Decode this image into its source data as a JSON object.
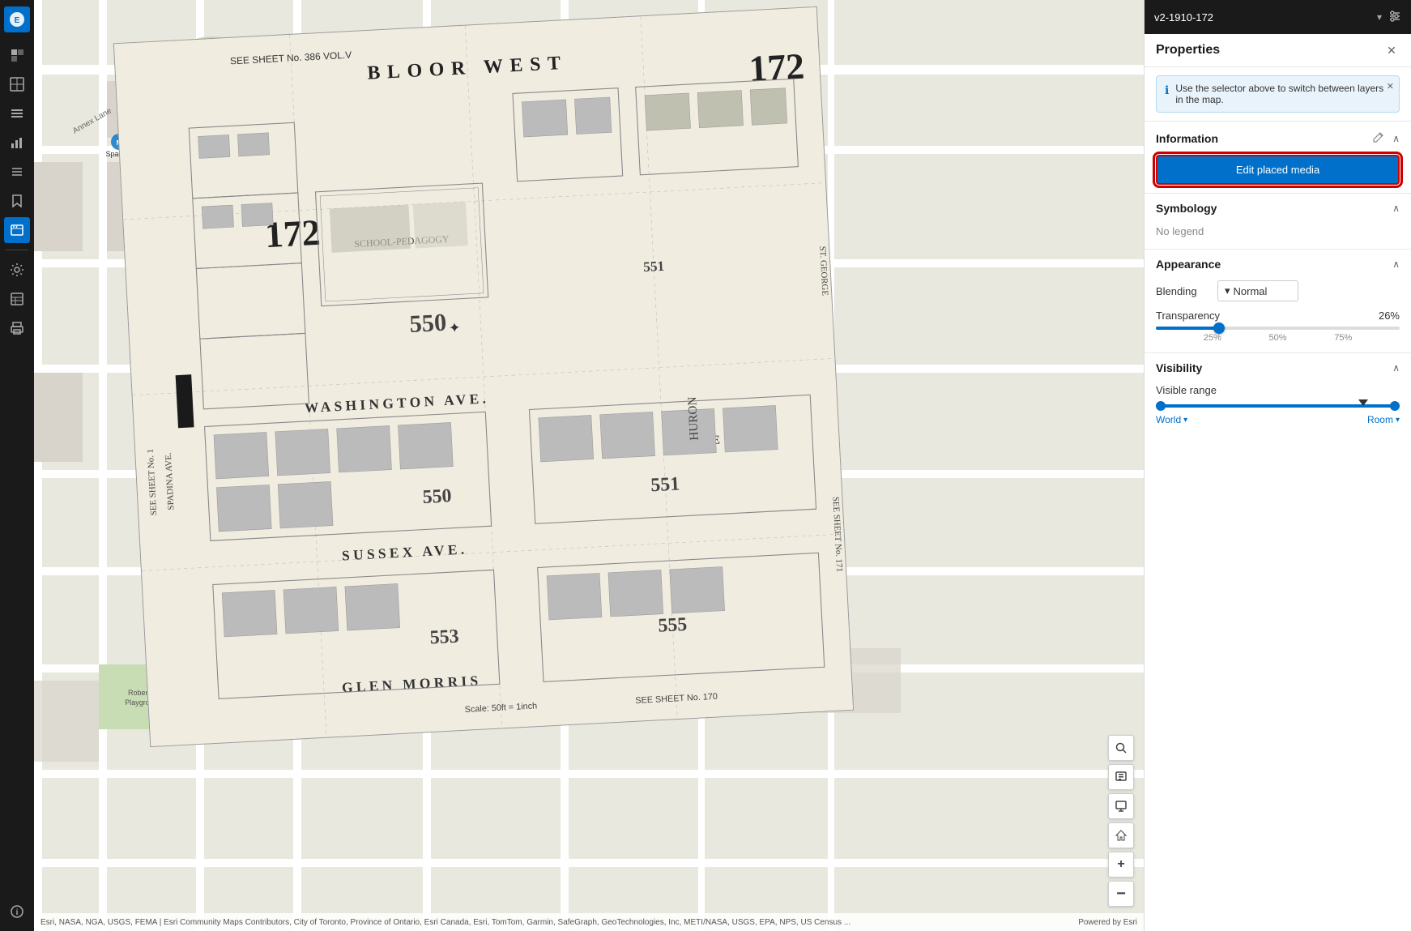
{
  "sidebar": {
    "logo_icon": "esri-logo",
    "items": [
      {
        "id": "layers",
        "icon": "◧",
        "label": "Layers",
        "active": false
      },
      {
        "id": "basemap",
        "icon": "⊞",
        "label": "Basemap",
        "active": false
      },
      {
        "id": "analysis",
        "icon": "▤",
        "label": "Analysis",
        "active": false
      },
      {
        "id": "charts",
        "icon": "📊",
        "label": "Charts",
        "active": false
      },
      {
        "id": "list",
        "icon": "☰",
        "label": "List",
        "active": false
      },
      {
        "id": "bookmark",
        "icon": "🔖",
        "label": "Bookmarks",
        "active": false
      },
      {
        "id": "media",
        "icon": "🖼",
        "label": "Media",
        "active": true
      },
      {
        "id": "settings",
        "icon": "⚙",
        "label": "Settings",
        "active": false
      },
      {
        "id": "tags",
        "icon": "⊟",
        "label": "Tags",
        "active": false
      },
      {
        "id": "print",
        "icon": "🖨",
        "label": "Print",
        "active": false
      }
    ],
    "bottom_items": [
      {
        "id": "info",
        "icon": "ℹ",
        "label": "Info",
        "active": false
      }
    ]
  },
  "map": {
    "attribution": "Esri, NASA, NGA, USGS, FEMA | Esri Community Maps Contributors, City of Toronto, Province of Ontario, Esri Canada, Esri, TomTom, Garmin, SafeGraph, GeoTechnologies, Inc, METI/NASA, USGS, EPA, NPS, US Census ...",
    "powered_by": "Powered by Esri"
  },
  "map_controls": [
    {
      "id": "search",
      "icon": "🔍",
      "label": "Search"
    },
    {
      "id": "popup",
      "icon": "⊡",
      "label": "Popup"
    },
    {
      "id": "monitor",
      "icon": "🖥",
      "label": "Monitor"
    },
    {
      "id": "home",
      "icon": "⌂",
      "label": "Home"
    },
    {
      "id": "zoom-in",
      "icon": "+",
      "label": "Zoom In"
    },
    {
      "id": "zoom-out",
      "icon": "−",
      "label": "Zoom Out"
    }
  ],
  "panel": {
    "layer_selector": {
      "label": "v2-1910-172",
      "chevron": "▾"
    },
    "properties_title": "Properties",
    "close_icon": "✕",
    "info_banner": {
      "text": "Use the selector above to switch between layers in the map.",
      "icon": "ℹ",
      "close_icon": "✕"
    },
    "sections": {
      "information": {
        "title": "Information",
        "collapsed": false,
        "chevron": "∧",
        "edit_media_btn": "Edit placed media"
      },
      "symbology": {
        "title": "Symbology",
        "collapsed": false,
        "chevron": "∧",
        "no_legend": "No legend"
      },
      "appearance": {
        "title": "Appearance",
        "collapsed": false,
        "chevron": "∧",
        "blending_label": "Blending",
        "blending_value": "Normal",
        "blending_arrow": "▾",
        "transparency_label": "Transparency",
        "transparency_value": "26%",
        "transparency_percent": 26,
        "range_labels": [
          "25%",
          "50%",
          "75%"
        ]
      },
      "visibility": {
        "title": "Visibility",
        "collapsed": false,
        "chevron": "∧",
        "visible_range_label": "Visible range",
        "left_endpoint": "World",
        "right_endpoint": "Room",
        "left_chevron": "▾",
        "right_chevron": "▾"
      }
    },
    "pencil_icon": "✏"
  }
}
